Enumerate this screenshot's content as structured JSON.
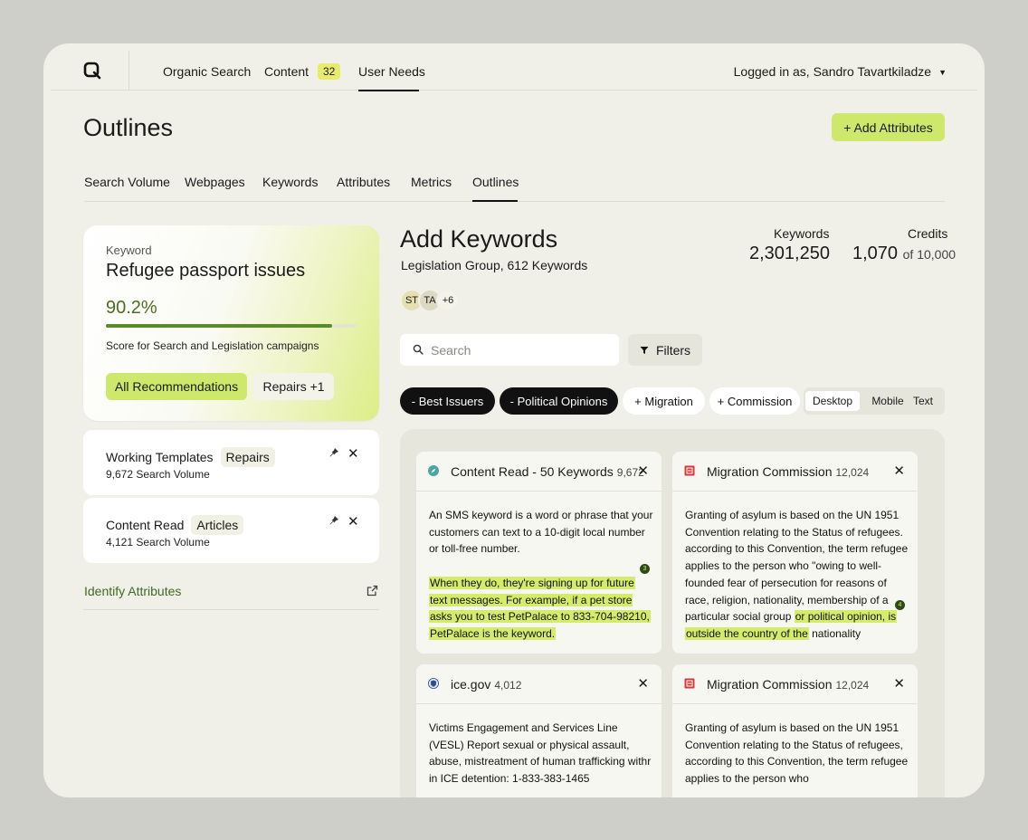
{
  "nav": {
    "items": [
      {
        "label": "Organic Search"
      },
      {
        "label": "Content",
        "badge": "32"
      },
      {
        "label": "User Needs",
        "active": true
      }
    ],
    "user": "Logged in as, Sandro Tavartkiladze"
  },
  "header": {
    "title": "Outlines",
    "add_button": "+ Add Attributes"
  },
  "tabs": [
    "Search Volume",
    "Webpages",
    "Keywords",
    "Attributes",
    "Metrics",
    "Outlines"
  ],
  "active_tab": "Outlines",
  "keyword_card": {
    "label": "Keyword",
    "value": "Refugee passport issues",
    "score": "90.2%",
    "score_fraction": 0.902,
    "description": "Score for Search and Legislation campaigns",
    "primary_button": "All Recommendations",
    "secondary_button": "Repairs +1"
  },
  "templates": [
    {
      "title": "Working Templates",
      "tag": "Repairs",
      "sub": "9,672 Search Volume"
    },
    {
      "title": "Content Read",
      "tag": "Articles",
      "sub": "4,121 Search Volume"
    }
  ],
  "identify_link": "Identify Attributes",
  "add_keywords": {
    "title": "Add Keywords",
    "subtitle": "Legislation Group, 612 Keywords",
    "stats": {
      "keywords_label": "Keywords",
      "keywords_value": "2,301,250",
      "credits_label": "Credits",
      "credits_used": "1,070",
      "credits_of": "of 10,000"
    },
    "avatars": [
      "ST",
      "TA",
      "+6"
    ],
    "search_placeholder": "Search",
    "filters_label": "Filters",
    "chips": [
      {
        "label": "- Best Issuers",
        "style": "dark"
      },
      {
        "label": "- Political Opinions",
        "style": "dark"
      },
      {
        "label": "+ Migration",
        "style": "light"
      },
      {
        "label": "+ Commission",
        "style": "light"
      }
    ],
    "view_options": [
      "Desktop",
      "Mobile",
      "Text"
    ],
    "active_view": "Desktop"
  },
  "results": [
    {
      "title": "Content Read - 50 Keywords",
      "count": "9,672",
      "icon": "compass-icon",
      "text": "An SMS keyword is a word or phrase that your customers can text to a 10-digit local number or toll-free number.",
      "highlight": "When they do, they're signing up for future text messages. For example, if a pet store asks you to test PetPalace to 833-704-98210, PetPalace is the keyword.",
      "marker": "3"
    },
    {
      "title": "Migration Commission",
      "count": "12,024",
      "icon": "document-icon",
      "text": "Granting of asylum is based on the UN 1951 Convention relating to the Status of refugees. according to this Convention, the term refugee applies to the person who \"owing to well-founded fear of persecution for reasons of race, religion, nationality, membership of a particular social group",
      "highlight": "or political opinion, is outside the country of the",
      "after": "nationality",
      "marker": "4"
    },
    {
      "title": "ice.gov",
      "count": "4,012",
      "icon": "shield-seal-icon",
      "text": "Victims Engagement and Services Line (VESL) Report sexual or physical assault, abuse, mistreatment of human trafficking withr in ICE detention: 1-833-383-1465"
    },
    {
      "title": "Migration Commission",
      "count": "12,024",
      "icon": "document-icon",
      "text": "Granting of asylum is based on the UN 1951 Convention relating to the Status of refugees, according to this Convention, the term refugee applies to the person who"
    }
  ],
  "colors": {
    "accent": "#cde86a",
    "highlight": "#d4ec6a",
    "background": "#f0f0e8",
    "dark": "#111111"
  }
}
